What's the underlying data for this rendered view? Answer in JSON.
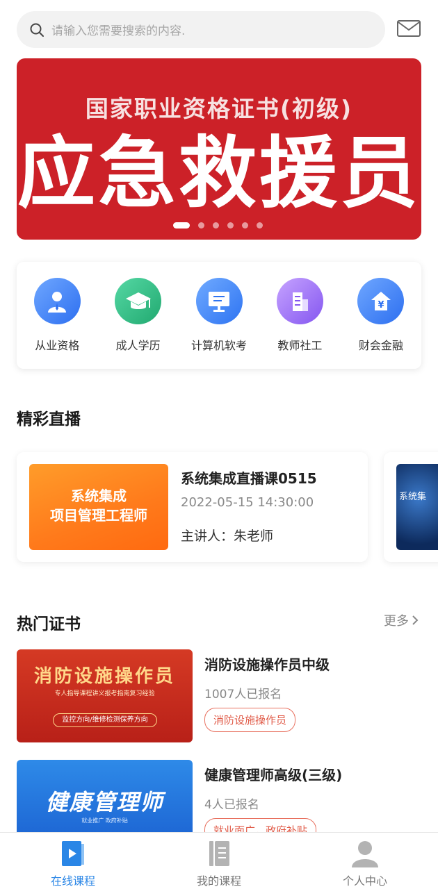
{
  "search": {
    "placeholder": "请输入您需要搜索的内容."
  },
  "header_icons": [
    "search-icon",
    "mail-icon"
  ],
  "banner": {
    "subtitle": "国家职业资格证书(初级)",
    "title": "应急救援员",
    "slide_count": 6,
    "active_slide": 1,
    "background_color": "#cc2128"
  },
  "categories": [
    {
      "label": "从业资格",
      "icon": "person-icon"
    },
    {
      "label": "成人学历",
      "icon": "graduation-cap-icon"
    },
    {
      "label": "计算机软考",
      "icon": "monitor-icon"
    },
    {
      "label": "教师社工",
      "icon": "building-icon"
    },
    {
      "label": "财会金融",
      "icon": "yuan-icon"
    }
  ],
  "live": {
    "section_title": "精彩直播",
    "items": [
      {
        "thumb_text_line1": "系统集成",
        "thumb_text_line2": "项目管理工程师",
        "title": "系统集成直播课0515",
        "time": "2022-05-15 14:30:00",
        "host": "主讲人：朱老师"
      },
      {
        "thumb_text": "系统集"
      }
    ]
  },
  "hot": {
    "section_title": "热门证书",
    "more_label": "更多",
    "items": [
      {
        "image_title": "消防设施操作员",
        "image_sub": "专人指导课程讲义报考指南复习经验",
        "image_pill": "监控方向/维修检测保养方向",
        "name": "消防设施操作员中级",
        "count": "1007人已报名",
        "tag": "消防设施操作员"
      },
      {
        "image_title": "健康管理师",
        "image_sub": "就业推广  政府补贴",
        "name": "健康管理师高级(三级)",
        "count": "4人已报名",
        "tag": "就业面广，政府补贴"
      }
    ]
  },
  "nav": [
    {
      "label": "在线课程",
      "icon": "play-book-icon",
      "active": true
    },
    {
      "label": "我的课程",
      "icon": "notebook-icon",
      "active": false
    },
    {
      "label": "个人中心",
      "icon": "user-icon",
      "active": false
    }
  ],
  "colors": {
    "accent": "#2a86e6",
    "tag": "#e05a47",
    "banner": "#cc2128"
  }
}
